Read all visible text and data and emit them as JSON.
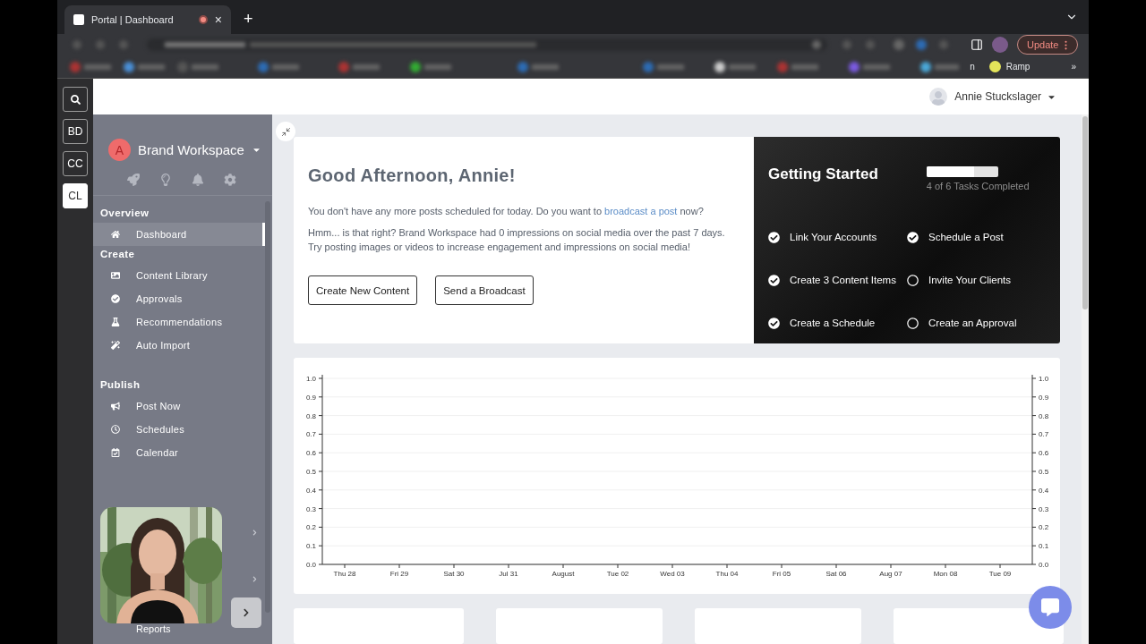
{
  "browser": {
    "tab": {
      "title": "Portal | Dashboard",
      "close": "×"
    },
    "new_tab": "+",
    "update_button": "Update",
    "bookmarks": [
      {
        "label": "n"
      },
      {
        "label": "Ramp"
      }
    ],
    "more_bookmarks": "»"
  },
  "rail": {
    "items": [
      {
        "kind": "search",
        "selected": false
      },
      {
        "kind": "text",
        "label": "BD",
        "selected": false
      },
      {
        "kind": "text",
        "label": "CC",
        "selected": false
      },
      {
        "kind": "text",
        "label": "CL",
        "selected": true
      }
    ]
  },
  "header": {
    "user": "Annie Stuckslager"
  },
  "sidebar": {
    "workspace": {
      "initial": "A",
      "name": "Brand Workspace"
    },
    "sections": [
      {
        "title": "Overview",
        "items": [
          {
            "label": "Dashboard",
            "selected": true
          }
        ]
      },
      {
        "title": "Create",
        "items": [
          {
            "label": "Content Library",
            "selected": false
          },
          {
            "label": "Approvals",
            "selected": false
          },
          {
            "label": "Recommendations",
            "selected": false
          },
          {
            "label": "Auto Import",
            "selected": false
          }
        ]
      },
      {
        "title": "Publish",
        "items": [
          {
            "label": "Post Now",
            "selected": false
          },
          {
            "label": "Schedules",
            "selected": false
          },
          {
            "label": "Calendar",
            "selected": false
          }
        ]
      }
    ],
    "footer_item": "Reports"
  },
  "welcome": {
    "title": "Good Afternoon, Annie!",
    "message": {
      "before": "You don't have any more posts scheduled for today. Do you want to ",
      "link": "broadcast a post",
      "after": " now?"
    },
    "note": "Hmm... is that right? Brand Workspace had 0 impressions on social media over the past 7 days. Try posting images or videos to increase engagement and impressions on social media!",
    "buttons": [
      "Create New Content",
      "Send a Broadcast"
    ]
  },
  "getting_started": {
    "title": "Getting Started",
    "progress": {
      "level": 0.67,
      "label": "4 of 6 Tasks Completed"
    },
    "tasks": [
      {
        "label": "Link Your Accounts",
        "checked": true
      },
      {
        "label": "Schedule a Post",
        "checked": true
      },
      {
        "label": "Create 3 Content Items",
        "checked": true
      },
      {
        "label": "Invite Your Clients",
        "checked": false
      },
      {
        "label": "Create a Schedule",
        "checked": true
      },
      {
        "label": "Create an Approval",
        "checked": false
      }
    ]
  },
  "chart": {
    "chart_data": {
      "type": "line",
      "categories": [
        "Thu 28",
        "Fri 29",
        "Sat 30",
        "Jul 31",
        "August",
        "Tue 02",
        "Wed 03",
        "Thu 04",
        "Fri 05",
        "Sat 06",
        "Aug 07",
        "Mon 08",
        "Tue 09"
      ],
      "ylim": [
        0,
        1
      ],
      "grid": true,
      "yticks": [
        {
          "value": 0,
          "label": "0.0"
        },
        {
          "value": 0.1,
          "label": "0.1"
        },
        {
          "value": 0.2,
          "label": "0.2"
        },
        {
          "value": 0.3,
          "label": "0.3"
        },
        {
          "value": 0.4,
          "label": "0.4"
        },
        {
          "value": 0.5,
          "label": "0.5"
        },
        {
          "value": 0.6,
          "label": "0.6"
        },
        {
          "value": 0.7,
          "label": "0.7"
        },
        {
          "value": 0.8,
          "label": "0.8"
        },
        {
          "value": 0.9,
          "label": "0.9"
        },
        {
          "value": 1,
          "label": "1.0"
        }
      ]
    }
  }
}
